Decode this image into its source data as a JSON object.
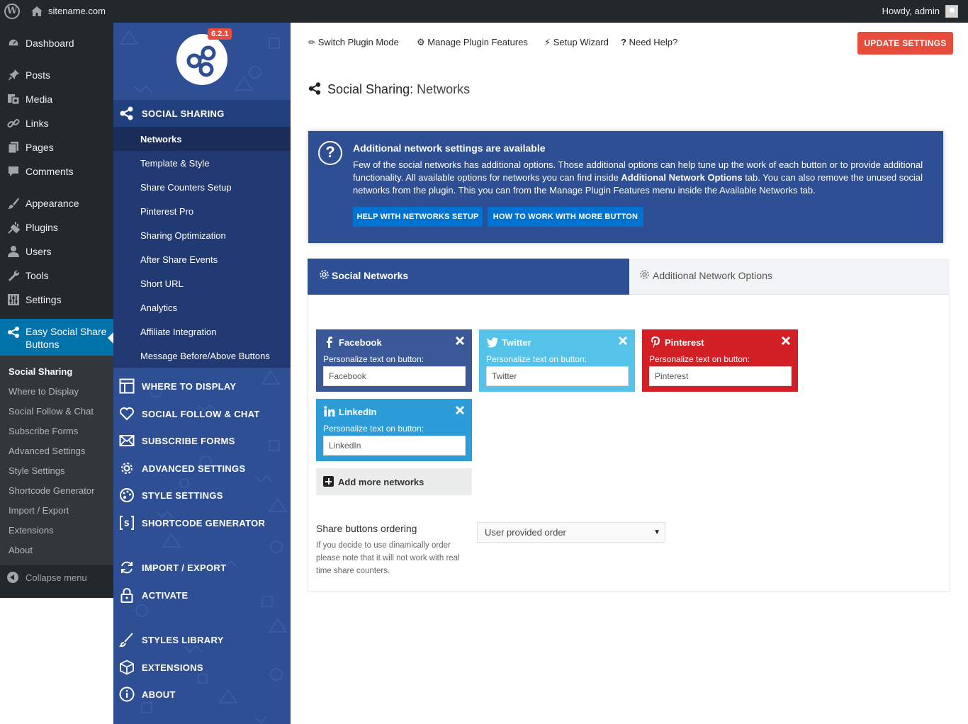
{
  "adminbar": {
    "site_name": "sitename.com",
    "greeting": "Howdy, admin"
  },
  "wp_menu": {
    "items": [
      {
        "label": "Dashboard",
        "icon": "dashboard-icon"
      },
      {
        "label": "Posts",
        "icon": "pin-icon"
      },
      {
        "label": "Media",
        "icon": "media-icon"
      },
      {
        "label": "Links",
        "icon": "link-icon"
      },
      {
        "label": "Pages",
        "icon": "page-icon"
      },
      {
        "label": "Comments",
        "icon": "comment-icon"
      },
      {
        "label": "Appearance",
        "icon": "brush-icon"
      },
      {
        "label": "Plugins",
        "icon": "plug-icon"
      },
      {
        "label": "Users",
        "icon": "user-icon"
      },
      {
        "label": "Tools",
        "icon": "wrench-icon"
      },
      {
        "label": "Settings",
        "icon": "sliders-icon"
      }
    ],
    "active": {
      "line1": "Easy Social Share",
      "line2": "Buttons"
    },
    "submenu": [
      "Social Sharing",
      "Where to Display",
      "Social Follow & Chat",
      "Subscribe Forms",
      "Advanced Settings",
      "Style Settings",
      "Shortcode Generator",
      "Import / Export",
      "Extensions",
      "About"
    ],
    "collapse": "Collapse menu"
  },
  "plugin_sidebar": {
    "version": "6.2.1",
    "social_sharing": "SOCIAL SHARING",
    "social_sharing_items": [
      "Networks",
      "Template & Style",
      "Share Counters Setup",
      "Pinterest Pro",
      "Sharing Optimization",
      "After Share Events",
      "Short URL",
      "Analytics",
      "Affiliate Integration",
      "Message Before/Above Buttons"
    ],
    "menu": [
      "WHERE TO DISPLAY",
      "SOCIAL FOLLOW & CHAT",
      "SUBSCRIBE FORMS",
      "ADVANCED SETTINGS",
      "STYLE SETTINGS",
      "SHORTCODE GENERATOR",
      "IMPORT / EXPORT",
      "ACTIVATE",
      "STYLES LIBRARY",
      "EXTENSIONS",
      "ABOUT"
    ]
  },
  "topnav": {
    "switch_mode": "Switch Plugin Mode",
    "manage_features": "Manage Plugin Features",
    "setup_wizard": "Setup Wizard",
    "need_help": "Need Help?",
    "update_button": "UPDATE SETTINGS"
  },
  "page": {
    "title_bold": "Social Sharing:",
    "title_thin": "Networks"
  },
  "notice": {
    "title": "Additional network settings are available",
    "body_part1": "Few of the social networks has additional options. Those additional options can help tune up the work of each button or to provide additional functionality. All available options for networks you can find inside ",
    "body_bold": "Additional Network Options",
    "body_part2": " tab. You can also remove the unused social networks from the plugin. This you can from the Manage Plugin Features menu inside the Available Networks tab.",
    "button1": "HELP WITH NETWORKS SETUP",
    "button2": "HOW TO WORK WITH MORE BUTTON"
  },
  "tabs": {
    "active": "Social Networks",
    "inactive": "Additional Network Options"
  },
  "networks": [
    {
      "name": "Facebook",
      "label": "Personalize text on button:",
      "value": "Facebook",
      "color": "#3b5998",
      "icon": "facebook-icon"
    },
    {
      "name": "Twitter",
      "label": "Personalize text on button:",
      "value": "Twitter",
      "color": "#55c2ea",
      "icon": "twitter-icon"
    },
    {
      "name": "Pinterest",
      "label": "Personalize text on button:",
      "value": "Pinterest",
      "color": "#d32027",
      "icon": "pinterest-icon"
    },
    {
      "name": "LinkedIn",
      "label": "Personalize text on button:",
      "value": "LinkedIn",
      "color": "#2d9dd9",
      "icon": "linkedin-icon"
    }
  ],
  "add_more": "Add more networks",
  "ordering": {
    "title": "Share buttons ordering",
    "description": "If you decide to use dinamically order please note that it will not work with real time share counters.",
    "selected": "User provided order"
  },
  "colors": {
    "wp_dark": "#23282d",
    "wp_blue": "#0073aa",
    "plugin_blue": "#2e4f93",
    "accent_red": "#e74c3c",
    "button_blue": "#0073d1"
  }
}
